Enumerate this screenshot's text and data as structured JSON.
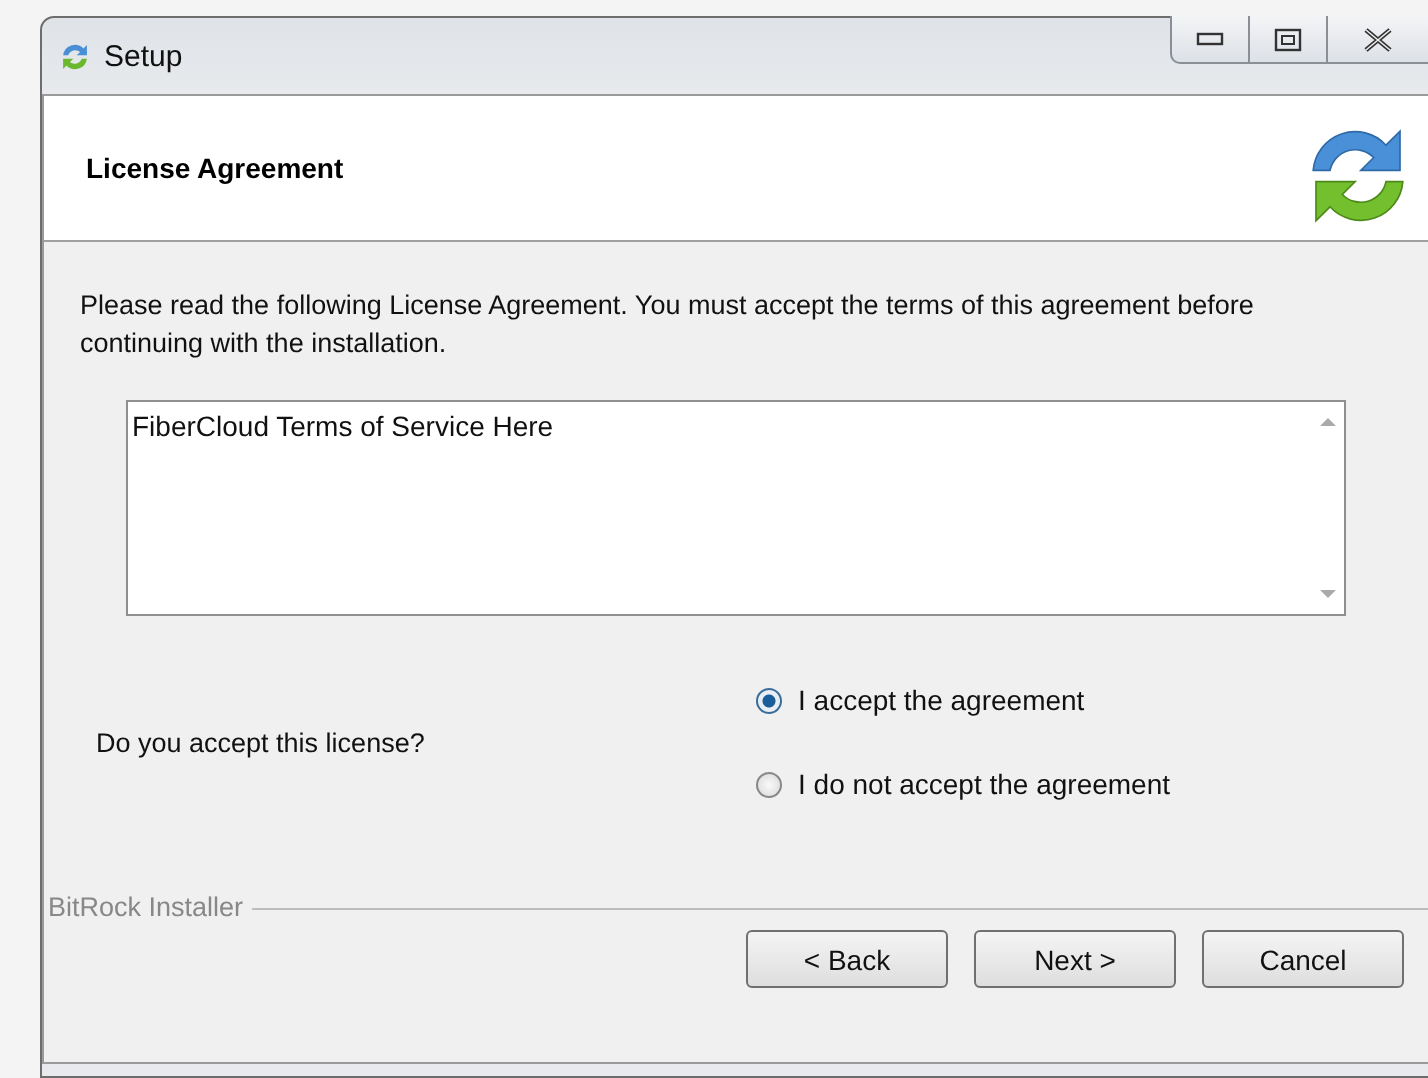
{
  "window": {
    "title": "Setup"
  },
  "header": {
    "title": "License Agreement"
  },
  "intro": "Please read the following License Agreement. You must accept the terms of this agreement before continuing with the installation.",
  "license_text": "FiberCloud Terms of Service Here",
  "question": "Do you accept this license?",
  "options": [
    {
      "label": "I accept the agreement",
      "selected": true
    },
    {
      "label": "I do not accept the agreement",
      "selected": false
    }
  ],
  "footer": {
    "brand": "BitRock Installer"
  },
  "buttons": [
    "< Back",
    "Next >",
    "Cancel"
  ]
}
